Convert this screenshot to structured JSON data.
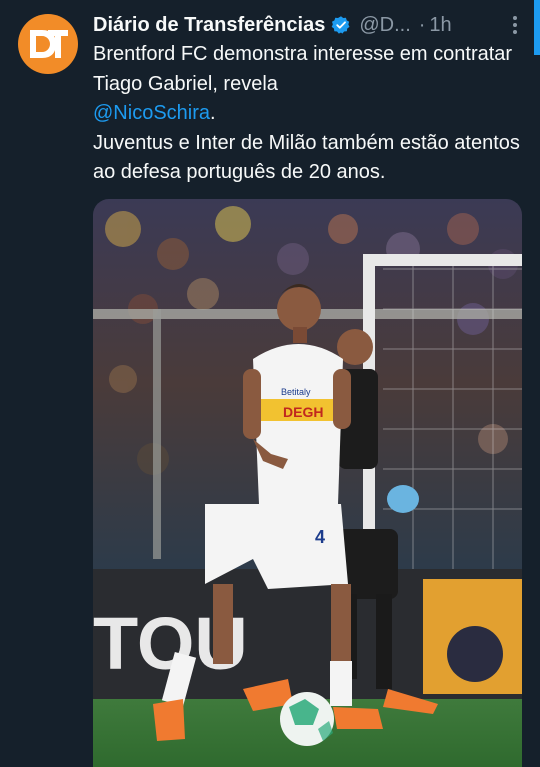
{
  "account": {
    "name": "Diário de Transferências",
    "handle": "@D...",
    "separator": "·",
    "time": "1h",
    "avatar_color": "#f28c28",
    "verified_color": "#1d9bf0"
  },
  "tweet": {
    "line1": "Brentford FC demonstra interesse em contratar Tiago Gabriel, revela",
    "mention": "@NicoSchira",
    "mention_suffix": ".",
    "line2": "Juventus e Inter de Milão também estão atentos ao defesa português de 20 anos."
  },
  "media": {
    "type": "football-photo",
    "shirt_sponsor_top": "Betitaly",
    "shirt_sponsor": "DEGH",
    "shirt_number": "4",
    "board_text": "TOU"
  },
  "colors": {
    "background": "#15202b",
    "text": "#f7f9f9",
    "secondary": "#8b98a5",
    "link": "#1d9bf0"
  },
  "icons": [
    "verified-badge-icon",
    "more-options-icon"
  ]
}
